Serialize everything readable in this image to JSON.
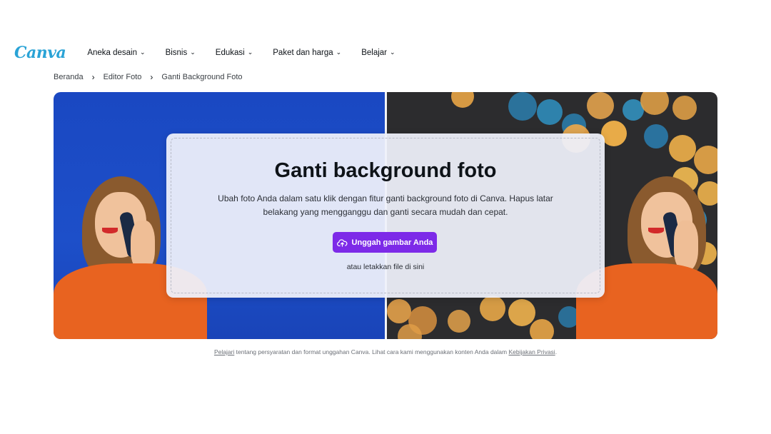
{
  "brand": {
    "logo_text": "Canva"
  },
  "nav": {
    "items": [
      {
        "label": "Aneka desain"
      },
      {
        "label": "Bisnis"
      },
      {
        "label": "Edukasi"
      },
      {
        "label": "Paket dan harga"
      },
      {
        "label": "Belajar"
      }
    ]
  },
  "breadcrumb": [
    {
      "label": "Beranda"
    },
    {
      "label": "Editor Foto"
    },
    {
      "label": "Ganti Background Foto"
    }
  ],
  "hero": {
    "title": "Ganti background foto",
    "description": "Ubah foto Anda dalam satu klik dengan fitur ganti background foto di Canva. Hapus latar belakang yang mengganggu dan ganti secara mudah dan cepat.",
    "upload_button_label": "Unggah gambar Anda",
    "drop_hint": "atau letakkan file di sini"
  },
  "footer": {
    "link_learn": "Pelajari",
    "text_middle": " tentang persyaratan dan format unggahan Canva. Lihat cara kami menggunakan konten Anda dalam ",
    "link_privacy": "Kebijakan Privasi",
    "text_end": "."
  },
  "colors": {
    "brand_purple": "#7d2ae8",
    "logo_blue": "#2aa3d6",
    "left_background": "#1d4fc9",
    "right_background": "#2c2c2e"
  },
  "icons": {
    "nav_chevron": "chevron-down-icon",
    "breadcrumb_separator": "chevron-right-icon",
    "upload": "cloud-upload-icon"
  }
}
